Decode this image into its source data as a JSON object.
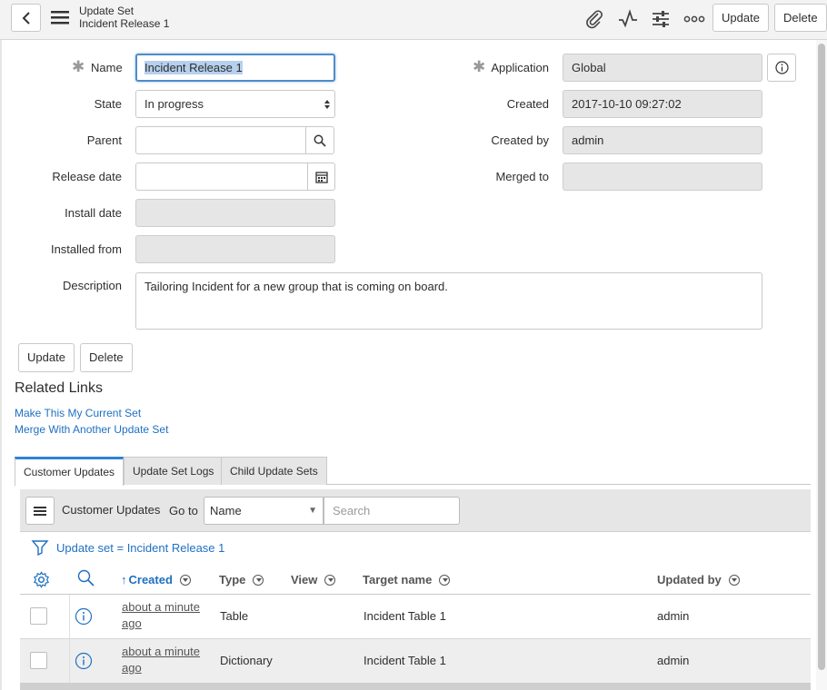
{
  "header": {
    "record_type": "Update Set",
    "record_name": "Incident Release 1",
    "buttons": {
      "update": "Update",
      "delete": "Delete"
    }
  },
  "form": {
    "name": {
      "label": "Name",
      "value": "Incident Release 1"
    },
    "state": {
      "label": "State",
      "value": "In progress"
    },
    "parent": {
      "label": "Parent",
      "value": ""
    },
    "release_date": {
      "label": "Release date",
      "value": ""
    },
    "install_date": {
      "label": "Install date",
      "value": ""
    },
    "installed_from": {
      "label": "Installed from",
      "value": ""
    },
    "description": {
      "label": "Description",
      "value": "Tailoring Incident for a new group that is coming on board."
    },
    "application": {
      "label": "Application",
      "value": "Global"
    },
    "created": {
      "label": "Created",
      "value": "2017-10-10 09:27:02"
    },
    "created_by": {
      "label": "Created by",
      "value": "admin"
    },
    "merged_to": {
      "label": "Merged to",
      "value": ""
    }
  },
  "form_buttons": {
    "update": "Update",
    "delete": "Delete"
  },
  "related_links": {
    "title": "Related Links",
    "links": [
      "Make This My Current Set",
      "Merge With Another Update Set"
    ]
  },
  "tabs": [
    "Customer Updates",
    "Update Set Logs",
    "Child Update Sets"
  ],
  "list": {
    "title": "Customer Updates",
    "goto_label": "Go to",
    "goto_field": "Name",
    "search_placeholder": "Search",
    "filter": "Update set = Incident Release 1",
    "columns": [
      "Created",
      "Type",
      "View",
      "Target name",
      "Updated by"
    ],
    "rows": [
      {
        "created": "about a minute ago",
        "type": "Table",
        "view": "",
        "target_name": "Incident Table 1",
        "updated_by": "admin"
      },
      {
        "created": "about a minute ago",
        "type": "Dictionary",
        "view": "",
        "target_name": "Incident Table 1",
        "updated_by": "admin"
      }
    ]
  },
  "colors": {
    "accent": "#2e83d3",
    "link": "#1f70c1",
    "readonly_bg": "#e6e6e6"
  }
}
